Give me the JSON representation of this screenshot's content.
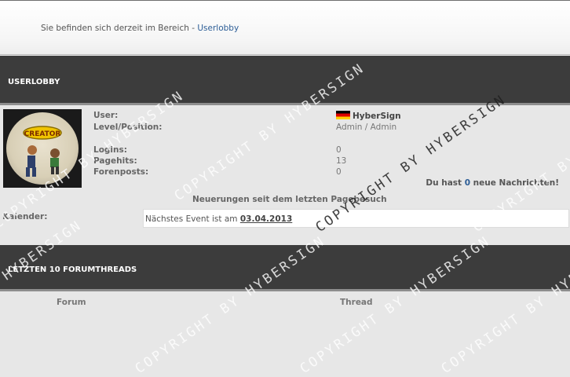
{
  "breadcrumb": {
    "prefix": "Sie befinden sich derzeit im Bereich - ",
    "link": "Userlobby"
  },
  "sections": {
    "userlobby": "USERLOBBY",
    "threads": "LETZTEN 10 FORUMTHREADS"
  },
  "profile": {
    "user_label": "User:",
    "user_value": "HyberSign",
    "level_label": "Level/Position:",
    "level_value": "Admin / Admin",
    "logins_label": "Logins:",
    "logins_value": "0",
    "pagehits_label": "Pagehits:",
    "pagehits_value": "13",
    "forenposts_label": "Forenposts:",
    "forenposts_value": "0"
  },
  "messages": {
    "prefix": "Du hast ",
    "count": "0",
    "suffix": " neue Nachrichten!"
  },
  "changes_text": "Neuerungen seit dem letzten Pagebesuch",
  "calendar": {
    "label": "Kalender:",
    "text": "Nächstes Event ist am ",
    "date": "03.04.2013"
  },
  "threads_table": {
    "col_forum": "Forum",
    "col_thread": "Thread"
  },
  "avatar_caption": "CREATOR",
  "watermark": "COPYRIGHT BY HYBERSIGN",
  "colors": {
    "header_bg": "#3c3c3c",
    "link": "#2c5d96",
    "page_bg": "#e7e7e7"
  },
  "flag_icon": "german-flag-icon"
}
